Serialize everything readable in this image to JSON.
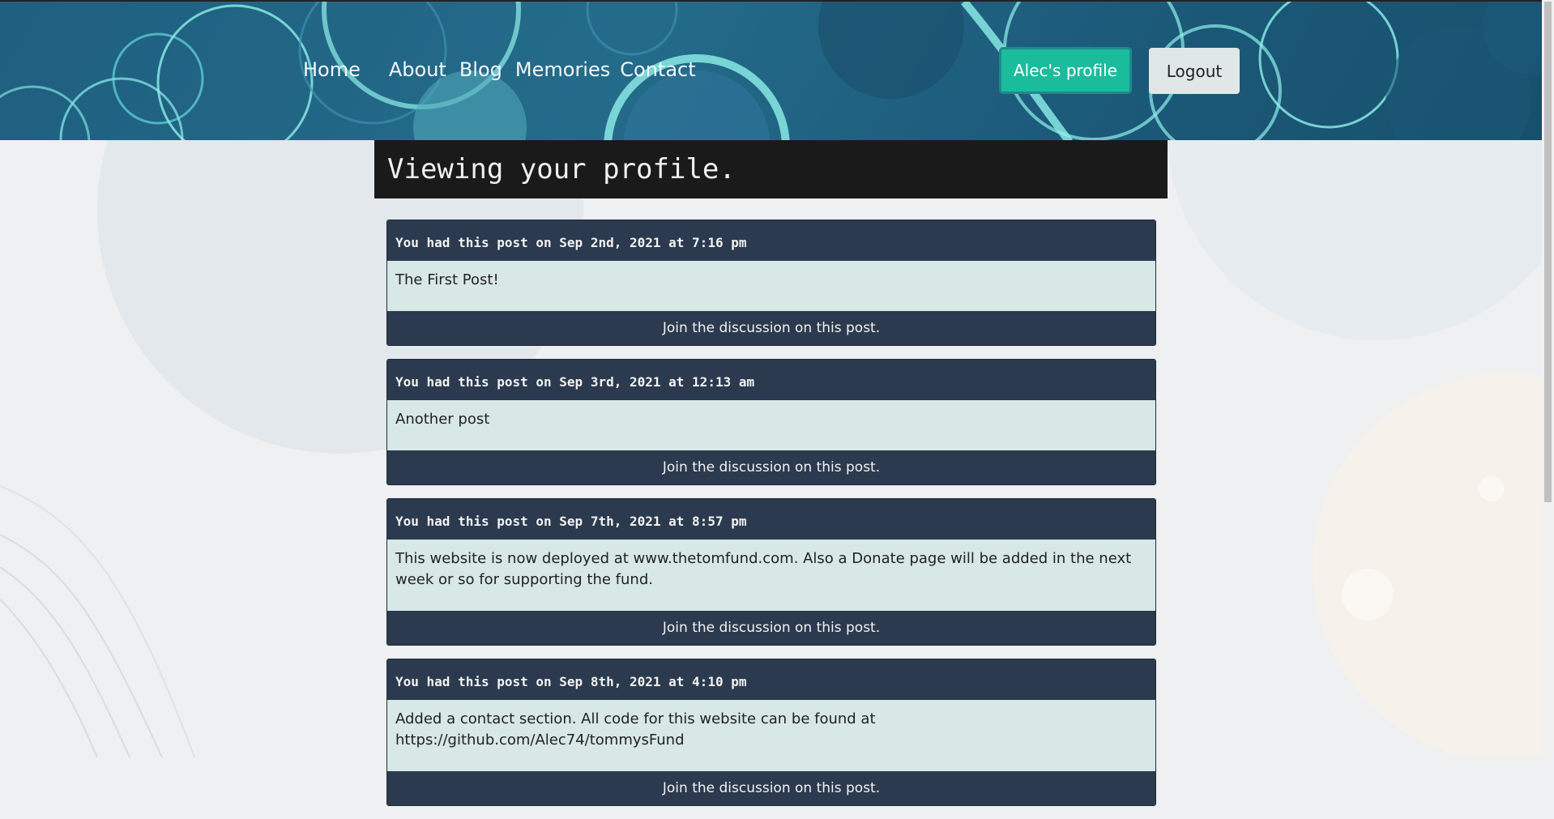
{
  "nav": {
    "items": [
      {
        "label": "Home"
      },
      {
        "label": "About"
      },
      {
        "label": "Blog"
      },
      {
        "label": "Memories"
      },
      {
        "label": "Contact"
      }
    ]
  },
  "header": {
    "profile_button": "Alec's profile",
    "logout_button": "Logout"
  },
  "page": {
    "title": "Viewing your profile."
  },
  "posts": [
    {
      "header": "You had this post on Sep 2nd, 2021 at 7:16 pm",
      "body": "The First Post!",
      "footer": "Join the discussion on this post."
    },
    {
      "header": "You had this post on Sep 3rd, 2021 at 12:13 am",
      "body": "Another post",
      "footer": "Join the discussion on this post."
    },
    {
      "header": "You had this post on Sep 7th, 2021 at 8:57 pm",
      "body": "This website is now deployed at www.thetomfund.com. Also a Donate page will be added in the next week or so for supporting the fund.",
      "footer": "Join the discussion on this post."
    },
    {
      "header": "You had this post on Sep 8th, 2021 at 4:10 pm",
      "body": "Added a contact section. All code for this website can be found at https://github.com/Alec74/tommysFund",
      "footer": "Join the discussion on this post."
    }
  ],
  "colors": {
    "header_bg": "#1f5f80",
    "accent_teal": "#1abc9c",
    "post_header_bg": "#2b3a4f",
    "post_body_bg": "#d7e8e6",
    "title_bar_bg": "#1a1a1a"
  }
}
